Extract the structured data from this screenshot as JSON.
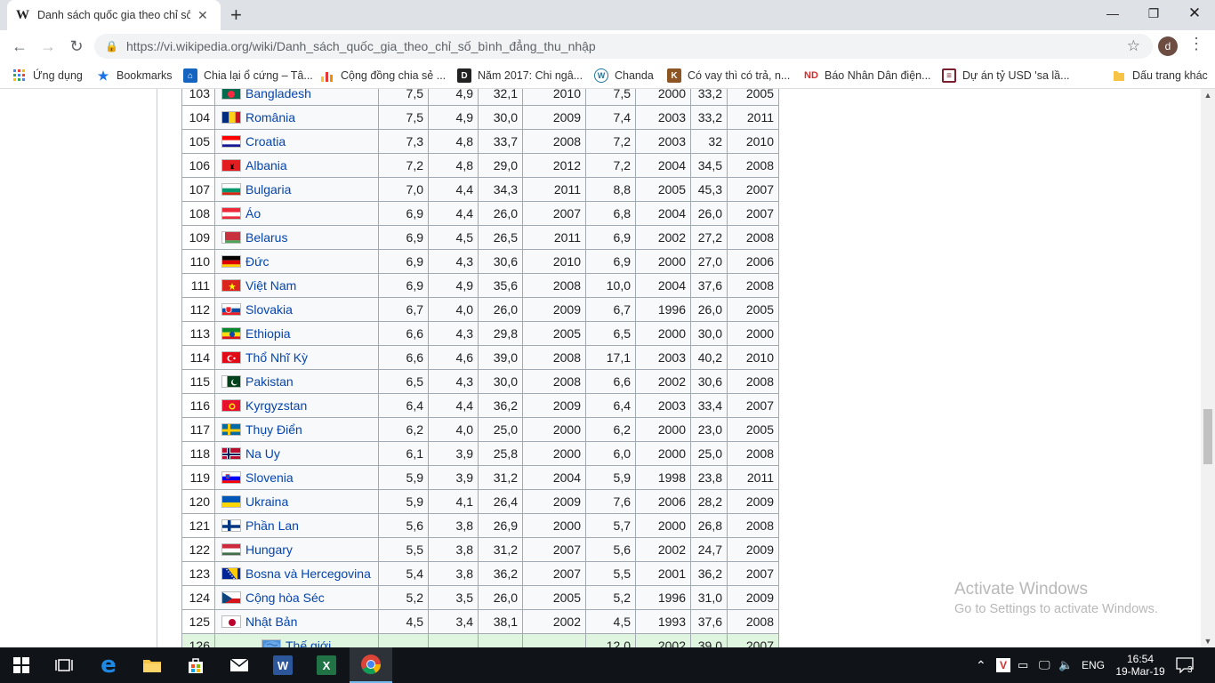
{
  "browser": {
    "tab_title": "Danh sách quốc gia theo chỉ số bình đẳng thu nhập",
    "tab_favicon": "W",
    "url": "https://vi.wikipedia.org/wiki/Danh_sách_quốc_gia_theo_chỉ_số_bình_đẳng_thu_nhập",
    "profile_initial": "d",
    "bookmarks": [
      {
        "label": "Ứng dụng",
        "icon": "apps-grid-icon",
        "color": "#4285f4"
      },
      {
        "label": "Bookmarks",
        "icon": "star-icon",
        "color": "#1a73e8"
      },
      {
        "label": "Chia lại ổ cứng – Tâ...",
        "icon": "site-icon",
        "color": "#1565c0"
      },
      {
        "label": "Cộng đồng chia sẻ ...",
        "icon": "bar-chart-icon",
        "color": "#e53935"
      },
      {
        "label": "Năm 2017: Chi ngâ...",
        "icon": "d-logo-icon",
        "color": "#222222"
      },
      {
        "label": "Chanda",
        "icon": "wordpress-icon",
        "color": "#21759b"
      },
      {
        "label": "Có vay thì có trả, n...",
        "icon": "k-logo-icon",
        "color": "#8d5524"
      },
      {
        "label": "Báo Nhân Dân điện...",
        "icon": "nd-logo-icon",
        "color": "#d32f2f"
      },
      {
        "label": "Dự án tỷ USD 'sa lầ...",
        "icon": "news-icon",
        "color": "#7b1f2e"
      }
    ],
    "other_bookmarks": "Dấu trang khác"
  },
  "table": {
    "rows": [
      {
        "rank": "103",
        "country": "Bangladesh",
        "flag": "bd",
        "v1": "7,5",
        "v2": "4,9",
        "v3": "32,1",
        "y1": "2010",
        "v4": "7,5",
        "y2": "2000",
        "v5": "33,2",
        "y3": "2005"
      },
      {
        "rank": "104",
        "country": "România",
        "flag": "ro",
        "v1": "7,5",
        "v2": "4,9",
        "v3": "30,0",
        "y1": "2009",
        "v4": "7,4",
        "y2": "2003",
        "v5": "33,2",
        "y3": "2011"
      },
      {
        "rank": "105",
        "country": "Croatia",
        "flag": "hr",
        "v1": "7,3",
        "v2": "4,8",
        "v3": "33,7",
        "y1": "2008",
        "v4": "7,2",
        "y2": "2003",
        "v5": "32",
        "y3": "2010"
      },
      {
        "rank": "106",
        "country": "Albania",
        "flag": "al",
        "v1": "7,2",
        "v2": "4,8",
        "v3": "29,0",
        "y1": "2012",
        "v4": "7,2",
        "y2": "2004",
        "v5": "34,5",
        "y3": "2008"
      },
      {
        "rank": "107",
        "country": "Bulgaria",
        "flag": "bg",
        "v1": "7,0",
        "v2": "4,4",
        "v3": "34,3",
        "y1": "2011",
        "v4": "8,8",
        "y2": "2005",
        "v5": "45,3",
        "y3": "2007"
      },
      {
        "rank": "108",
        "country": "Áo",
        "flag": "at",
        "v1": "6,9",
        "v2": "4,4",
        "v3": "26,0",
        "y1": "2007",
        "v4": "6,8",
        "y2": "2004",
        "v5": "26,0",
        "y3": "2007"
      },
      {
        "rank": "109",
        "country": "Belarus",
        "flag": "by",
        "v1": "6,9",
        "v2": "4,5",
        "v3": "26,5",
        "y1": "2011",
        "v4": "6,9",
        "y2": "2002",
        "v5": "27,2",
        "y3": "2008"
      },
      {
        "rank": "110",
        "country": "Đức",
        "flag": "de",
        "v1": "6,9",
        "v2": "4,3",
        "v3": "30,6",
        "y1": "2010",
        "v4": "6,9",
        "y2": "2000",
        "v5": "27,0",
        "y3": "2006"
      },
      {
        "rank": "111",
        "country": "Việt Nam",
        "flag": "vn",
        "v1": "6,9",
        "v2": "4,9",
        "v3": "35,6",
        "y1": "2008",
        "v4": "10,0",
        "y2": "2004",
        "v5": "37,6",
        "y3": "2008"
      },
      {
        "rank": "112",
        "country": "Slovakia",
        "flag": "sk",
        "v1": "6,7",
        "v2": "4,0",
        "v3": "26,0",
        "y1": "2009",
        "v4": "6,7",
        "y2": "1996",
        "v5": "26,0",
        "y3": "2005"
      },
      {
        "rank": "113",
        "country": "Ethiopia",
        "flag": "et",
        "v1": "6,6",
        "v2": "4,3",
        "v3": "29,8",
        "y1": "2005",
        "v4": "6,5",
        "y2": "2000",
        "v5": "30,0",
        "y3": "2000"
      },
      {
        "rank": "114",
        "country": "Thổ Nhĩ Kỳ",
        "flag": "tr",
        "v1": "6,6",
        "v2": "4,6",
        "v3": "39,0",
        "y1": "2008",
        "v4": "17,1",
        "y2": "2003",
        "v5": "40,2",
        "y3": "2010"
      },
      {
        "rank": "115",
        "country": "Pakistan",
        "flag": "pk",
        "v1": "6,5",
        "v2": "4,3",
        "v3": "30,0",
        "y1": "2008",
        "v4": "6,6",
        "y2": "2002",
        "v5": "30,6",
        "y3": "2008"
      },
      {
        "rank": "116",
        "country": "Kyrgyzstan",
        "flag": "kg",
        "v1": "6,4",
        "v2": "4,4",
        "v3": "36,2",
        "y1": "2009",
        "v4": "6,4",
        "y2": "2003",
        "v5": "33,4",
        "y3": "2007"
      },
      {
        "rank": "117",
        "country": "Thụy Điển",
        "flag": "se",
        "v1": "6,2",
        "v2": "4,0",
        "v3": "25,0",
        "y1": "2000",
        "v4": "6,2",
        "y2": "2000",
        "v5": "23,0",
        "y3": "2005"
      },
      {
        "rank": "118",
        "country": "Na Uy",
        "flag": "no",
        "v1": "6,1",
        "v2": "3,9",
        "v3": "25,8",
        "y1": "2000",
        "v4": "6,0",
        "y2": "2000",
        "v5": "25,0",
        "y3": "2008"
      },
      {
        "rank": "119",
        "country": "Slovenia",
        "flag": "si",
        "v1": "5,9",
        "v2": "3,9",
        "v3": "31,2",
        "y1": "2004",
        "v4": "5,9",
        "y2": "1998",
        "v5": "23,8",
        "y3": "2011"
      },
      {
        "rank": "120",
        "country": "Ukraina",
        "flag": "ua",
        "v1": "5,9",
        "v2": "4,1",
        "v3": "26,4",
        "y1": "2009",
        "v4": "7,6",
        "y2": "2006",
        "v5": "28,2",
        "y3": "2009"
      },
      {
        "rank": "121",
        "country": "Phần Lan",
        "flag": "fi",
        "v1": "5,6",
        "v2": "3,8",
        "v3": "26,9",
        "y1": "2000",
        "v4": "5,7",
        "y2": "2000",
        "v5": "26,8",
        "y3": "2008"
      },
      {
        "rank": "122",
        "country": "Hungary",
        "flag": "hu",
        "v1": "5,5",
        "v2": "3,8",
        "v3": "31,2",
        "y1": "2007",
        "v4": "5,6",
        "y2": "2002",
        "v5": "24,7",
        "y3": "2009"
      },
      {
        "rank": "123",
        "country": "Bosna và Hercegovina",
        "flag": "ba",
        "v1": "5,4",
        "v2": "3,8",
        "v3": "36,2",
        "y1": "2007",
        "v4": "5,5",
        "y2": "2001",
        "v5": "36,2",
        "y3": "2007"
      },
      {
        "rank": "124",
        "country": "Cộng hòa Séc",
        "flag": "cz",
        "v1": "5,2",
        "v2": "3,5",
        "v3": "26,0",
        "y1": "2005",
        "v4": "5,2",
        "y2": "1996",
        "v5": "31,0",
        "y3": "2009"
      },
      {
        "rank": "125",
        "country": "Nhật Bản",
        "flag": "jp",
        "v1": "4,5",
        "v2": "3,4",
        "v3": "38,1",
        "y1": "2002",
        "v4": "4,5",
        "y2": "1993",
        "v5": "37,6",
        "y3": "2008"
      }
    ],
    "world_row": {
      "rank": "126",
      "country": "Thế giới",
      "flag": "world",
      "v1": "",
      "v2": "",
      "v3": "",
      "y1": "",
      "v4": "12,0",
      "y2": "2002",
      "v5": "39,0",
      "y3": "2007"
    }
  },
  "watermark": {
    "line1": "Activate Windows",
    "line2": "Go to Settings to activate Windows."
  },
  "taskbar": {
    "language": "ENG",
    "time": "16:54",
    "date": "19-Mar-19",
    "notification_count": "3",
    "apps": [
      "windows-start-icon",
      "task-view-icon",
      "edge-icon",
      "file-explorer-icon",
      "store-icon",
      "mail-icon",
      "word-icon",
      "excel-icon",
      "chrome-icon"
    ]
  }
}
